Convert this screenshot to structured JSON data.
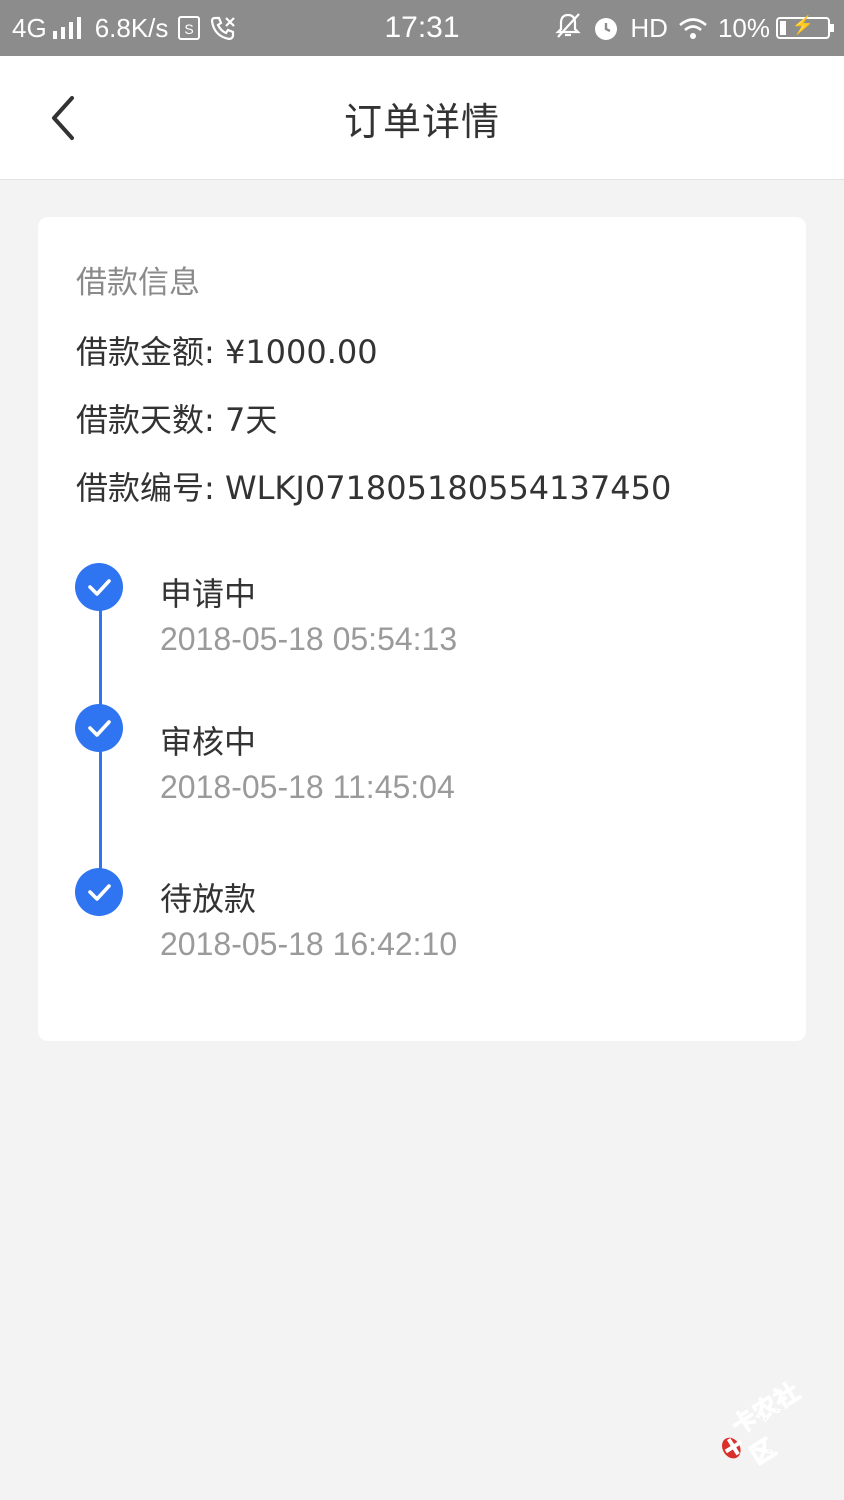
{
  "status_bar": {
    "network": "4G",
    "speed": "6.8K/s",
    "time": "17:31",
    "hd": "HD",
    "battery": "10%"
  },
  "header": {
    "title": "订单详情"
  },
  "loan_info": {
    "section_title": "借款信息",
    "amount_row": "借款金额: ¥1000.00",
    "days_row": "借款天数: 7天",
    "number_row": "借款编号: WLKJ071805180554137450"
  },
  "timeline": [
    {
      "label": "申请中",
      "time": "2018-05-18 05:54:13"
    },
    {
      "label": "审核中",
      "time": "2018-05-18 11:45:04"
    },
    {
      "label": "待放款",
      "time": "2018-05-18 16:42:10"
    }
  ],
  "watermark": {
    "text": "卡农社区"
  },
  "colors": {
    "accent": "#2f74f0",
    "status_bar": "#8c8c8c",
    "background": "#f3f3f3"
  }
}
